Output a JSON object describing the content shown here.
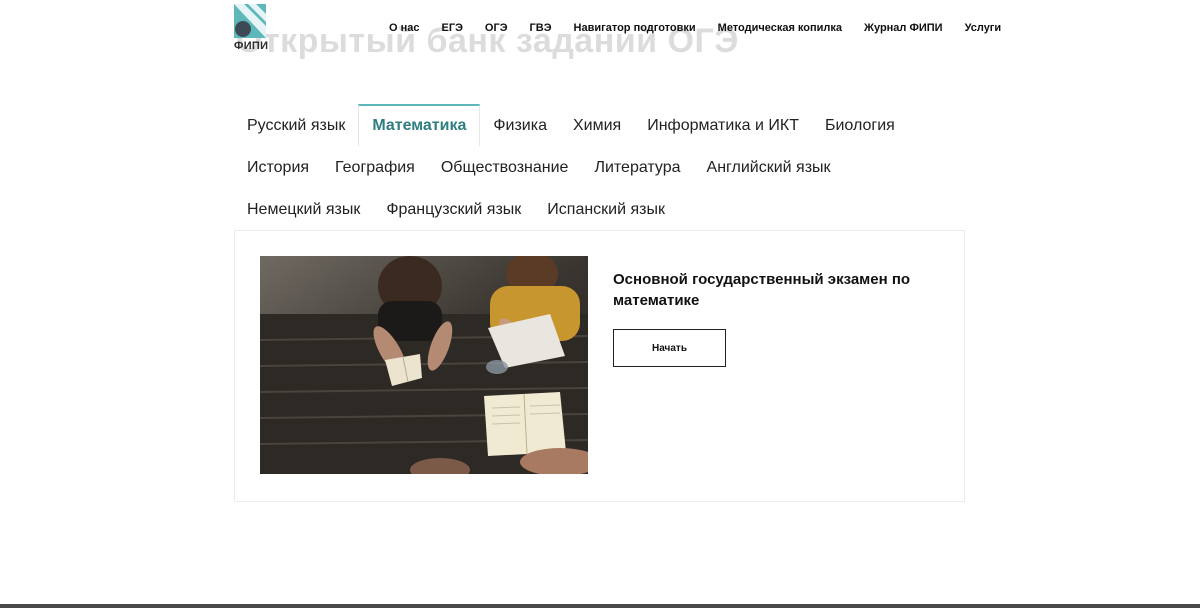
{
  "page_title": "Открытый банк заданий ОГЭ",
  "logo": {
    "text": "ФИПИ"
  },
  "nav": [
    "О нас",
    "ЕГЭ",
    "ОГЭ",
    "ГВЭ",
    "Навигатор подготовки",
    "Методическая копилка",
    "Журнал ФИПИ",
    "Услуги"
  ],
  "subjects": [
    "Русский язык",
    "Математика",
    "Физика",
    "Химия",
    "Информатика и ИКТ",
    "Биология",
    "История",
    "География",
    "Обществознание",
    "Литература",
    "Английский язык",
    "Немецкий язык",
    "Французский язык",
    "Испанский язык"
  ],
  "active_subject": "Математика",
  "card": {
    "title": "Основной государственный экзамен по математике",
    "button_label": "Начать"
  },
  "colors": {
    "accent": "#5db7bb",
    "active_tab_text": "#2e7d80"
  }
}
